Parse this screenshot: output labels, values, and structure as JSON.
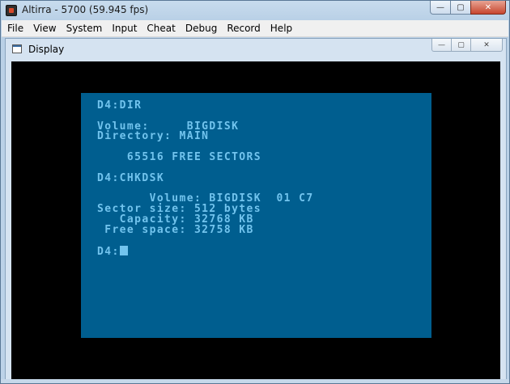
{
  "window": {
    "title": "Altirra - 5700 (59.945 fps)",
    "caption_minimize": "—",
    "caption_maximize": "▢",
    "caption_close": "✕"
  },
  "menubar": {
    "items": [
      "File",
      "View",
      "System",
      "Input",
      "Cheat",
      "Debug",
      "Record",
      "Help"
    ]
  },
  "display_pane": {
    "title": "Display",
    "caption_minimize": "—",
    "caption_maximize": "▢",
    "caption_close": "✕"
  },
  "screen": {
    "lines": [
      "D4:DIR",
      "",
      "Volume:     BIGDISK",
      "Directory: MAIN",
      "",
      "    65516 FREE SECTORS",
      "",
      "D4:CHKDSK",
      "",
      "       Volume: BIGDISK  01 C7",
      "Sector size: 512 bytes",
      "   Capacity: 32768 KB",
      " Free space: 32758 KB",
      "",
      "D4:"
    ]
  },
  "colors": {
    "screen_background": "#005e8f",
    "screen_text": "#72c4ee",
    "border": "#000000"
  }
}
